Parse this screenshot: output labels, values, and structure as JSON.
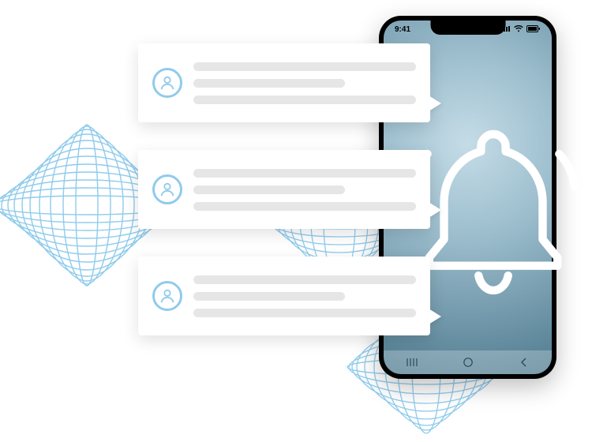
{
  "phone": {
    "status_bar": {
      "time": "9:41",
      "signal_label": "signal",
      "wifi_label": "wifi",
      "battery_label": "battery"
    },
    "nav": {
      "recent_label": "|||",
      "home_label": "○",
      "back_label": "‹"
    }
  },
  "bell": {
    "label": "notification"
  },
  "cards": [
    {
      "title_placeholder": "",
      "body_placeholder": ""
    },
    {
      "title_placeholder": "",
      "body_placeholder": ""
    },
    {
      "title_placeholder": "",
      "body_placeholder": ""
    }
  ],
  "colors": {
    "accent": "#8fcbec",
    "line": "#e6e6e6",
    "phone_black": "#000000",
    "screen_grad_inner": "#c5dce7",
    "screen_grad_outer": "#4f7a8f"
  }
}
